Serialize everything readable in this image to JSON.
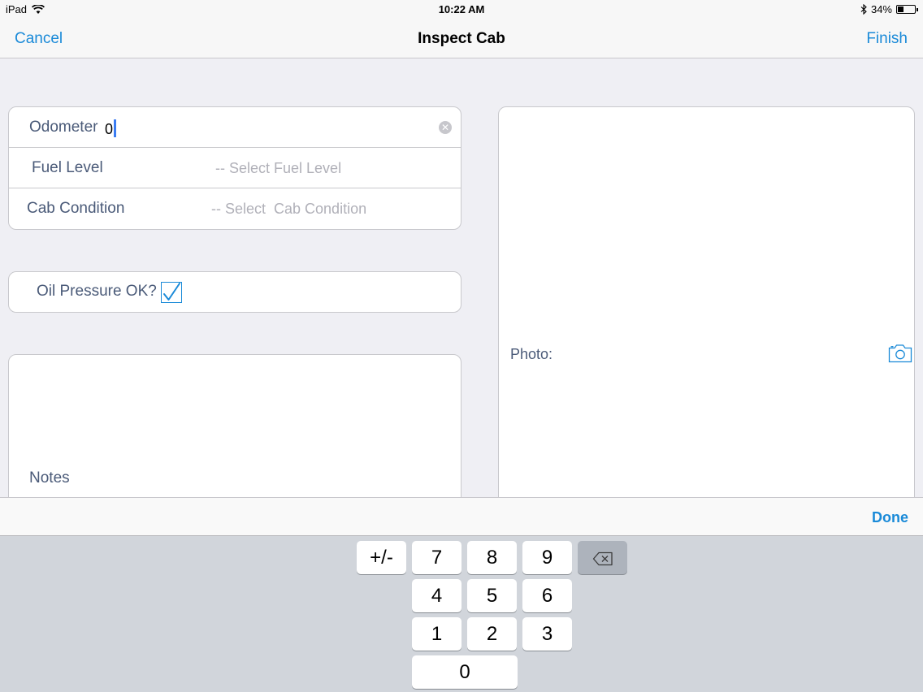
{
  "status_bar": {
    "device": "iPad",
    "time": "10:22 AM",
    "battery": "34%",
    "battery_level": 0.34
  },
  "nav": {
    "cancel": "Cancel",
    "title": "Inspect Cab",
    "finish": "Finish"
  },
  "form": {
    "odometer_label": "Odometer",
    "odometer_value": "0",
    "fuel_label": "Fuel Level",
    "fuel_placeholder": "-- Select Fuel Level",
    "cab_label": "Cab Condition",
    "cab_placeholder": "-- Select  Cab Condition",
    "oil_label": "Oil Pressure OK?",
    "oil_checked": true,
    "notes_label": "Notes",
    "photo_label": "Photo:"
  },
  "accessory": {
    "done": "Done"
  },
  "keypad": {
    "plus_minus": "+/-",
    "k7": "7",
    "k8": "8",
    "k9": "9",
    "k4": "4",
    "k5": "5",
    "k6": "6",
    "k1": "1",
    "k2": "2",
    "k3": "3",
    "k0": "0"
  },
  "colors": {
    "accent": "#1a8ad8",
    "label": "#4a5a78",
    "placeholder": "#b0b0b8"
  },
  "icons": [
    "wifi-icon",
    "bluetooth-icon",
    "battery-icon",
    "clear-icon",
    "checkmark-icon",
    "camera-icon",
    "backspace-icon"
  ]
}
